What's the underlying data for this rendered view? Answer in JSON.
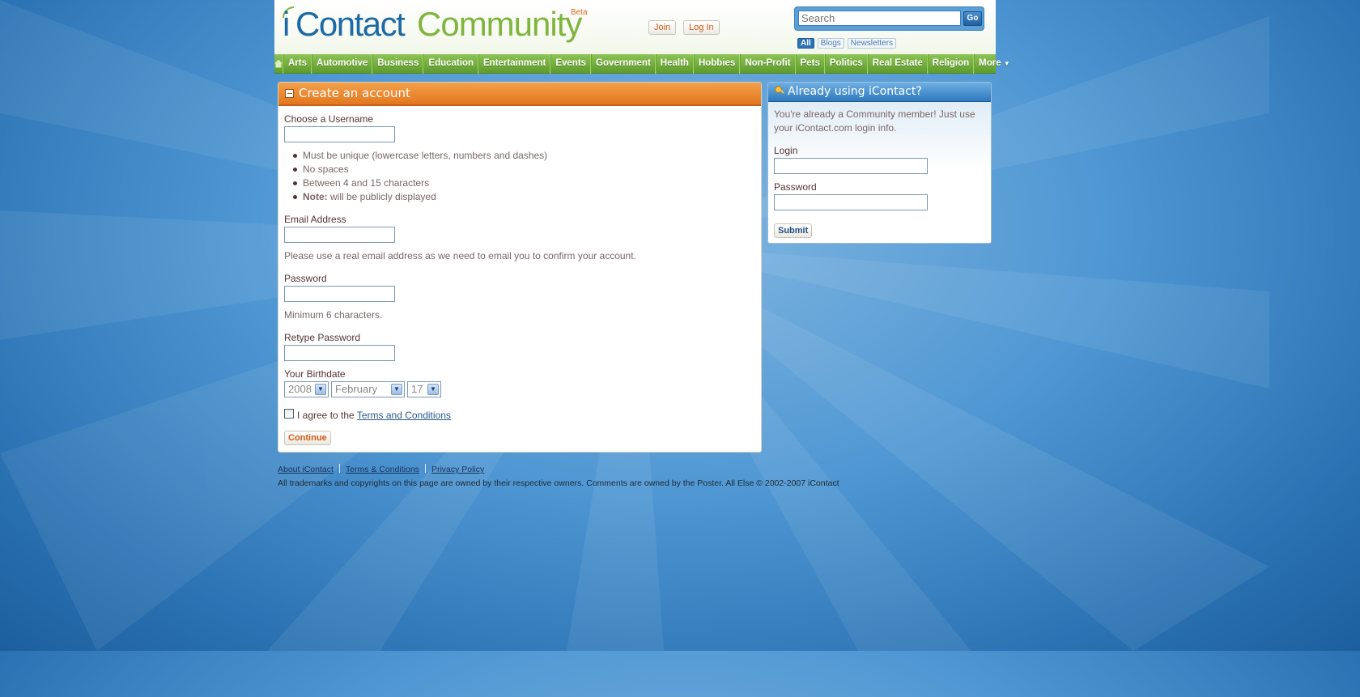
{
  "header": {
    "logo": {
      "i": "i",
      "contact": "Contact",
      "community": "Community",
      "beta": "Beta"
    },
    "join_label": "Join",
    "login_label": "Log In",
    "search": {
      "placeholder": "Search",
      "go_label": "Go",
      "tabs": [
        "All",
        "Blogs",
        "Newsletters"
      ],
      "active_tab": "All"
    }
  },
  "nav": {
    "items": [
      "Arts",
      "Automotive",
      "Business",
      "Education",
      "Entertainment",
      "Events",
      "Government",
      "Health",
      "Hobbies",
      "Non-Profit",
      "Pets",
      "Politics",
      "Real Estate",
      "Religion",
      "More"
    ],
    "home_icon": "home-icon"
  },
  "create": {
    "title": "Create an account",
    "username_label": "Choose a Username",
    "rules": [
      "Must be unique (lowercase letters, numbers and dashes)",
      "No spaces",
      "Between 4 and 15 characters"
    ],
    "note_bold": "Note:",
    "note_text": " will be publicly displayed",
    "email_label": "Email Address",
    "email_hint": "Please use a real email address as we need to email you to confirm your account.",
    "password_label": "Password",
    "password_hint": "Minimum 6 characters.",
    "retype_label": "Retype Password",
    "birthdate_label": "Your Birthdate",
    "birth_year": "2008",
    "birth_month": "February",
    "birth_day": "17",
    "agree_text": "I agree to the ",
    "terms_link": "Terms and Conditions",
    "continue_label": "Continue"
  },
  "existing": {
    "title": "Already using iContact?",
    "text": "You're already a Community member! Just use your iContact.com login info.",
    "login_label": "Login",
    "password_label": "Password",
    "submit_label": "Submit"
  },
  "footer": {
    "links": [
      "About iContact",
      "Terms & Conditions",
      "Privacy Policy"
    ],
    "copyright": "All trademarks and copyrights on this page are owned by their respective owners. Comments are owned by the Poster. All Else © 2002-2007 iContact"
  },
  "colors": {
    "nav_green": "#6aa533",
    "header_orange": "#e2761f",
    "header_blue": "#2e78bd",
    "background_blue": "#4f97d3"
  }
}
